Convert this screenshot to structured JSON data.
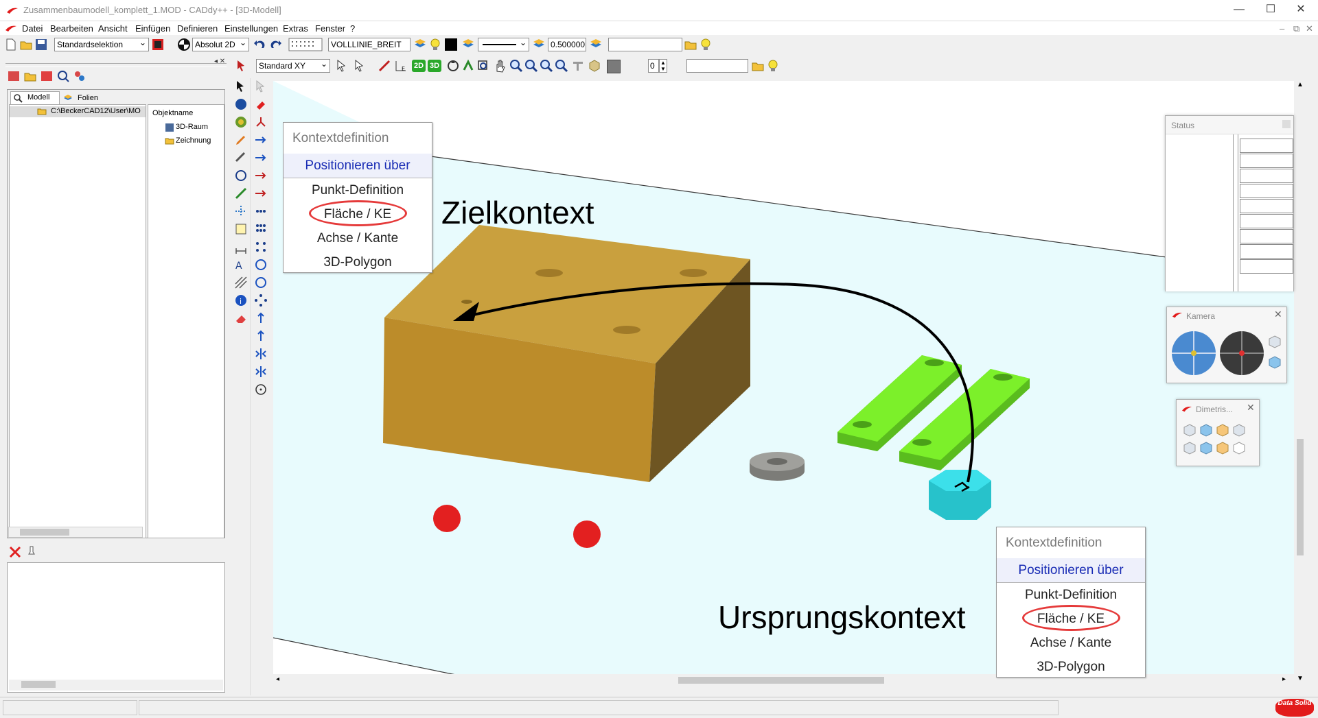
{
  "window": {
    "title": "Zusammenbaumodell_komplett_1.MOD - CADdy++ - [3D-Modell]",
    "controls": [
      "—",
      "☐",
      "✕"
    ],
    "mdi_controls": [
      "–",
      "⧉",
      "✕"
    ]
  },
  "menu": [
    "Datei",
    "Bearbeiten",
    "Ansicht",
    "Einfügen",
    "Definieren",
    "Einstellungen",
    "Extras",
    "Fenster",
    "?"
  ],
  "toolbar1": {
    "selection_mode": "Standardselektion",
    "coordinate_mode": "Absolut 2D",
    "line_style": "VOLLLINIE_BREIT",
    "line_width": "0.500000",
    "text_field": ""
  },
  "toolbar2": {
    "view_plane": "Standard XY",
    "btn_2d": "2D",
    "btn_3d": "3D",
    "layer_number": "0",
    "text_field": ""
  },
  "left_panel": {
    "tabs": [
      "Modell",
      "Folien"
    ],
    "tree_path": "C:\\BeckerCAD12\\User\\MO",
    "object_header": "Objektname",
    "objects": [
      "3D-Raum",
      "Zeichnung"
    ]
  },
  "context_menu_top": {
    "header": "Kontextdefinition",
    "highlight": "Positionieren über",
    "items": [
      "Punkt-Definition",
      "Fläche / KE",
      "Achse / Kante",
      "3D-Polygon"
    ]
  },
  "context_menu_bottom": {
    "header": "Kontextdefinition",
    "highlight": "Positionieren über",
    "items": [
      "Punkt-Definition",
      "Fläche / KE",
      "Achse / Kante",
      "3D-Polygon"
    ]
  },
  "annotations": {
    "target": "Zielkontext",
    "origin": "Ursprungskontext"
  },
  "floating_windows": {
    "status": "Status",
    "camera": "Kamera",
    "dimetric": "Dimetris..."
  },
  "brand": "Data Solid",
  "colors": {
    "viewport_floor": "#e8fbfd",
    "box": "#c9a03e",
    "green_parts": "#7cf02a",
    "hex_nut": "#33d8e0",
    "red_balls": "#e32020",
    "highlight_ring": "#e53a3a"
  }
}
